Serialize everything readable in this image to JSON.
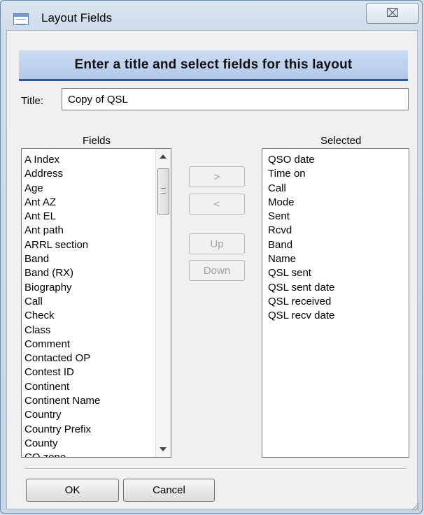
{
  "window": {
    "title": "Layout Fields",
    "close_glyph": "⌧"
  },
  "header": {
    "text": "Enter a title and select fields for this layout"
  },
  "title_field": {
    "label": "Title:",
    "value": "Copy of QSL"
  },
  "fields": {
    "label": "Fields",
    "items": [
      "A Index",
      "Address",
      "Age",
      "Ant AZ",
      "Ant EL",
      "Ant path",
      "ARRL section",
      "Band",
      "Band (RX)",
      "Biography",
      "Call",
      "Check",
      "Class",
      "Comment",
      "Contacted OP",
      "Contest ID",
      "Continent",
      "Continent Name",
      "Country",
      "Country Prefix",
      "County",
      "CQ zone"
    ]
  },
  "selected": {
    "label": "Selected",
    "items": [
      "QSO date",
      "Time on",
      "Call",
      "Mode",
      "Sent",
      "Rcvd",
      "Band",
      "Name",
      "QSL sent",
      "QSL sent date",
      "QSL received",
      "QSL recv date"
    ]
  },
  "buttons": {
    "add": ">",
    "remove": "<",
    "up": "Up",
    "down": "Down",
    "ok": "OK",
    "cancel": "Cancel"
  },
  "icons": {
    "app": "layout-window-icon",
    "close": "close-icon",
    "scroll_up": "scroll-up-arrow-icon",
    "scroll_down": "scroll-down-arrow-icon",
    "resize": "resize-grip-icon"
  }
}
